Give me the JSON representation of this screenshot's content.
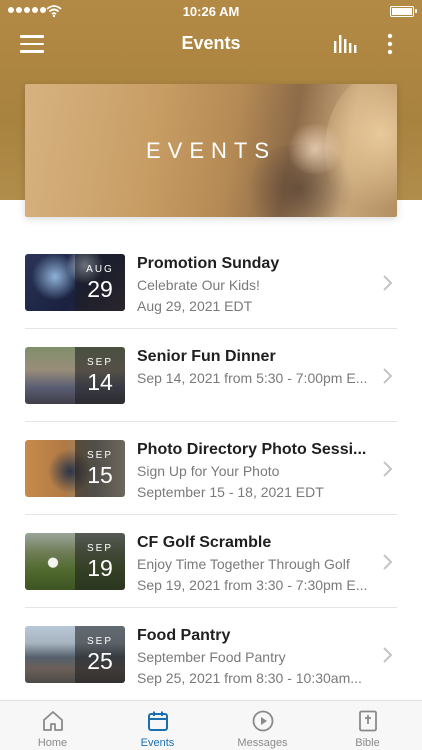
{
  "status_bar": {
    "time": "10:26 AM"
  },
  "header": {
    "title": "Events",
    "menu_icon": "hamburger-menu-icon",
    "audio_icon": "audio-bars-icon",
    "more_icon": "more-vertical-icon"
  },
  "banner": {
    "label": "EVENTS"
  },
  "events": [
    {
      "month": "AUG",
      "day": "29",
      "title": "Promotion Sunday",
      "subtitle": "Celebrate Our Kids!",
      "date": "Aug 29, 2021 EDT"
    },
    {
      "month": "SEP",
      "day": "14",
      "title": "Senior Fun Dinner",
      "subtitle": "Sep 14, 2021 from 5:30 - 7:00pm E...",
      "date": ""
    },
    {
      "month": "SEP",
      "day": "15",
      "title": "Photo Directory Photo Sessi...",
      "subtitle": "Sign Up for Your Photo",
      "date": "September 15 - 18, 2021 EDT"
    },
    {
      "month": "SEP",
      "day": "19",
      "title": "CF Golf Scramble",
      "subtitle": "Enjoy Time Together Through Golf",
      "date": "Sep 19, 2021 from 3:30 - 7:30pm E..."
    },
    {
      "month": "SEP",
      "day": "25",
      "title": "Food Pantry",
      "subtitle": "September Food Pantry",
      "date": "Sep 25, 2021 from 8:30 - 10:30am..."
    }
  ],
  "tabs": [
    {
      "label": "Home",
      "icon": "home-icon",
      "active": false
    },
    {
      "label": "Events",
      "icon": "calendar-icon",
      "active": true
    },
    {
      "label": "Messages",
      "icon": "play-circle-icon",
      "active": false
    },
    {
      "label": "Bible",
      "icon": "bible-icon",
      "active": false
    }
  ],
  "colors": {
    "header": "#b08845",
    "accent": "#1a6fb0"
  }
}
